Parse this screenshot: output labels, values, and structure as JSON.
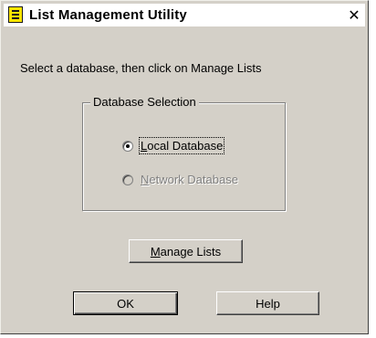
{
  "window": {
    "title": "List Management Utility",
    "close_label": "✕"
  },
  "instruction": "Select a database, then click on Manage Lists",
  "group": {
    "label": "Database Selection",
    "options": [
      {
        "accel": "L",
        "rest": "ocal Database",
        "selected": true,
        "enabled": true
      },
      {
        "accel": "N",
        "rest": "etwork Database",
        "selected": false,
        "enabled": false
      }
    ]
  },
  "buttons": {
    "manage": {
      "accel": "M",
      "rest": "anage Lists"
    },
    "ok": "OK",
    "help": "Help"
  }
}
